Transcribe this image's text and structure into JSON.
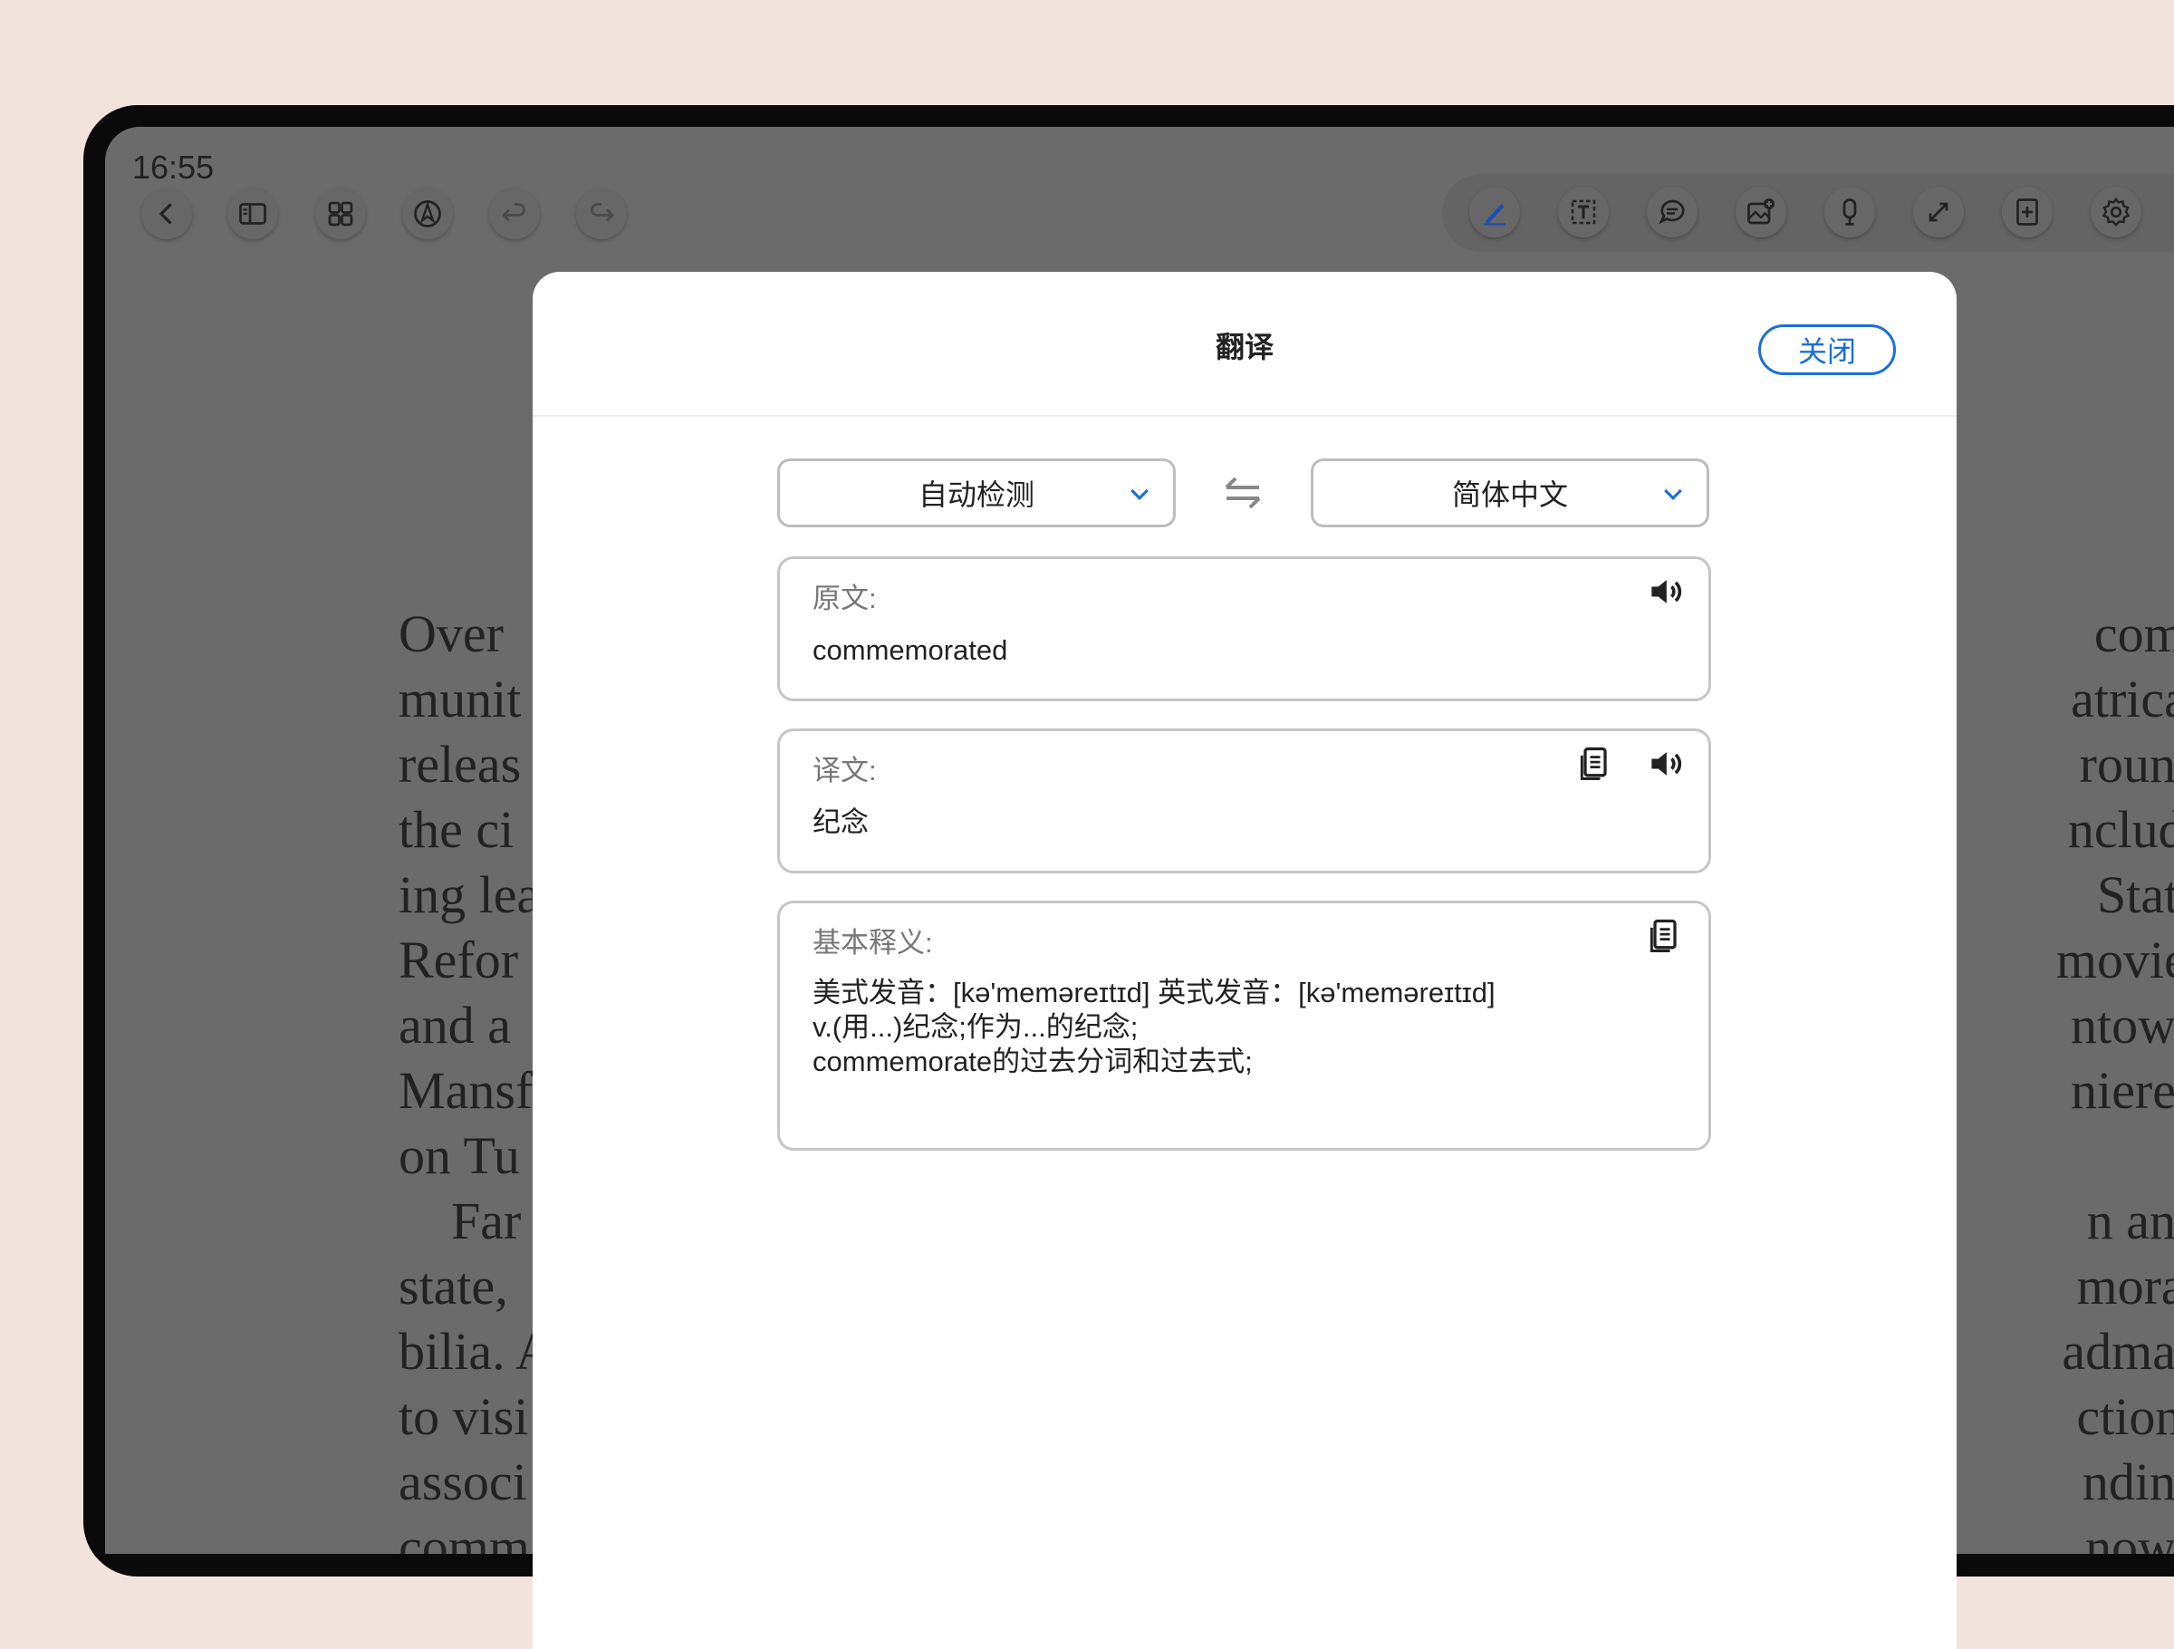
{
  "status_bar": {
    "time": "16:55"
  },
  "left_toolbar": [
    {
      "name": "back-icon"
    },
    {
      "name": "sidebar-icon"
    },
    {
      "name": "grid-icon"
    },
    {
      "name": "pen-nib-icon"
    },
    {
      "name": "undo-icon"
    },
    {
      "name": "redo-icon"
    }
  ],
  "right_toolbar": [
    {
      "name": "pen-icon",
      "color": "#1b4fb0"
    },
    {
      "name": "text-box-icon"
    },
    {
      "name": "comment-icon"
    },
    {
      "name": "image-add-icon"
    },
    {
      "name": "microphone-icon"
    },
    {
      "name": "expand-icon"
    },
    {
      "name": "add-page-icon"
    },
    {
      "name": "gear-icon"
    }
  ],
  "background_page": {
    "left_fragments": "Over\nmunit\nreleas\nthe ci\ning lea\nRefor\nand a\nMansf\non Tu\n    Far\nstate, \nbilia. A\nto visi\nassoci\ncomm",
    "right_fragments": "com-\natrical\nround\nnclud-\n State\nmovie;\nntown\nniered\nr.\nn and\nmora-\nadmap\nctions\nnding\nnown"
  },
  "dialog": {
    "title": "翻译",
    "close_label": "关闭",
    "source_lang": "自动检测",
    "target_lang": "简体中文",
    "source": {
      "label": "原文:",
      "text": "commemorated"
    },
    "translation": {
      "label": "译文:",
      "text": "纪念"
    },
    "definition": {
      "label": "基本释义:",
      "text": "美式发音：[kə'meməreɪtɪd] 英式发音：[kə'meməreɪtɪd]\nv.(用...)纪念;作为...的纪念;\ncommemorate的过去分词和过去式;"
    }
  },
  "colors": {
    "accent": "#1b6fd8",
    "overlay": "#6b6b6b",
    "backdrop": "#f2e4dc"
  }
}
